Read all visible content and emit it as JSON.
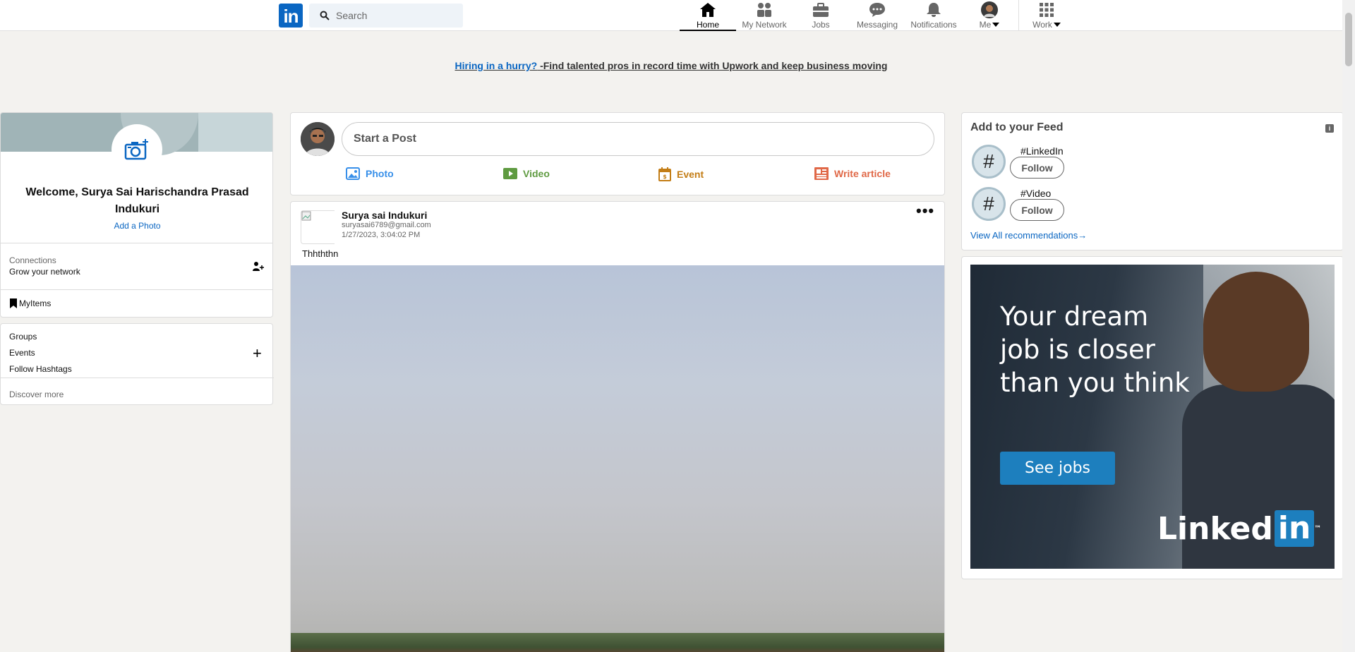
{
  "header": {
    "logo": "in",
    "search_placeholder": "Search",
    "nav": [
      {
        "label": "Home",
        "icon": "home-icon",
        "active": true
      },
      {
        "label": "My Network",
        "icon": "network-icon"
      },
      {
        "label": "Jobs",
        "icon": "briefcase-icon"
      },
      {
        "label": "Messaging",
        "icon": "message-icon"
      },
      {
        "label": "Notifications",
        "icon": "bell-icon"
      },
      {
        "label": "Me",
        "icon": "avatar"
      },
      {
        "label": "Work",
        "icon": "grid-icon"
      }
    ]
  },
  "promo": {
    "link_text": "Hiring in a hurry?",
    "rest_text": " -Find talented pros in record time with Upwork and keep business moving"
  },
  "profile": {
    "welcome": "Welcome, Surya Sai Harischandra Prasad Indukuri",
    "add_photo": "Add a Photo",
    "connections_label": "Connections",
    "connections_sub": "Grow your network",
    "my_items": "MyItems"
  },
  "groups": {
    "items": [
      "Groups",
      "Events",
      "Follow Hashtags"
    ],
    "discover": "Discover more"
  },
  "composer": {
    "placeholder": "Start a Post",
    "actions": [
      {
        "label": "Photo",
        "icon": "photo-icon",
        "color": "#378fe9"
      },
      {
        "label": "Video",
        "icon": "video-icon",
        "color": "#5f9b41"
      },
      {
        "label": "Event",
        "icon": "calendar-icon",
        "color": "#c37d16"
      },
      {
        "label": "Write article",
        "icon": "article-icon",
        "color": "#e06847"
      }
    ]
  },
  "post": {
    "author": "Surya sai Indukuri",
    "email": "suryasai6789@gmail.com",
    "timestamp": "1/27/2023, 3:04:02 PM",
    "text": "Thhththn",
    "more": "•••"
  },
  "feed": {
    "title": "Add to your Feed",
    "hashtags": [
      {
        "label": "#LinkedIn",
        "button": "Follow"
      },
      {
        "label": "#Video",
        "button": "Follow"
      }
    ],
    "view_all": "View All recommendations"
  },
  "ad": {
    "headline": "Your dream job is closer than you think",
    "button": "See jobs",
    "brand_text": "Linked",
    "brand_box": "in",
    "brand_mark": "™"
  },
  "colors": {
    "accent": "#0a66c2",
    "background": "#f3f2ef"
  }
}
